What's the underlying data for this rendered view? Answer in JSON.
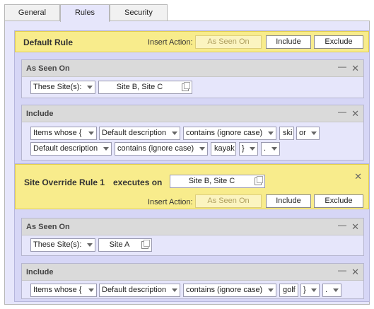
{
  "tabs": [
    {
      "label": "General",
      "active": false
    },
    {
      "label": "Rules",
      "active": true
    },
    {
      "label": "Security",
      "active": false
    }
  ],
  "default_rule": {
    "title": "Default Rule",
    "insert_action_label": "Insert Action:",
    "buttons": {
      "as_seen_on": "As Seen On",
      "include": "Include",
      "exclude": "Exclude"
    },
    "as_seen_on": {
      "title": "As Seen On",
      "sites_select": "These Site(s):",
      "sites_value": "Site B, Site C"
    },
    "include": {
      "title": "Include",
      "row1": [
        "Items whose {",
        "Default description",
        "contains (ignore case)",
        "ski",
        "or"
      ],
      "row2": [
        "Default description",
        "contains (ignore case)",
        "kayak",
        "}",
        "."
      ]
    }
  },
  "override_rule": {
    "title": "Site Override Rule 1",
    "executes_on_label": "executes on",
    "executes_on_value": "Site B, Site C",
    "insert_action_label": "Insert Action:",
    "buttons": {
      "as_seen_on": "As Seen On",
      "include": "Include",
      "exclude": "Exclude"
    },
    "as_seen_on": {
      "title": "As Seen On",
      "sites_select": "These Site(s):",
      "sites_value": "Site A"
    },
    "include": {
      "title": "Include",
      "row1": [
        "Items whose {",
        "Default description",
        "contains (ignore case)",
        "golf",
        "}",
        "."
      ]
    }
  },
  "icons": {
    "minimize": "minimize-icon",
    "close": "close-icon",
    "copy": "copy-icon",
    "dropdown": "chevron-down-icon"
  }
}
